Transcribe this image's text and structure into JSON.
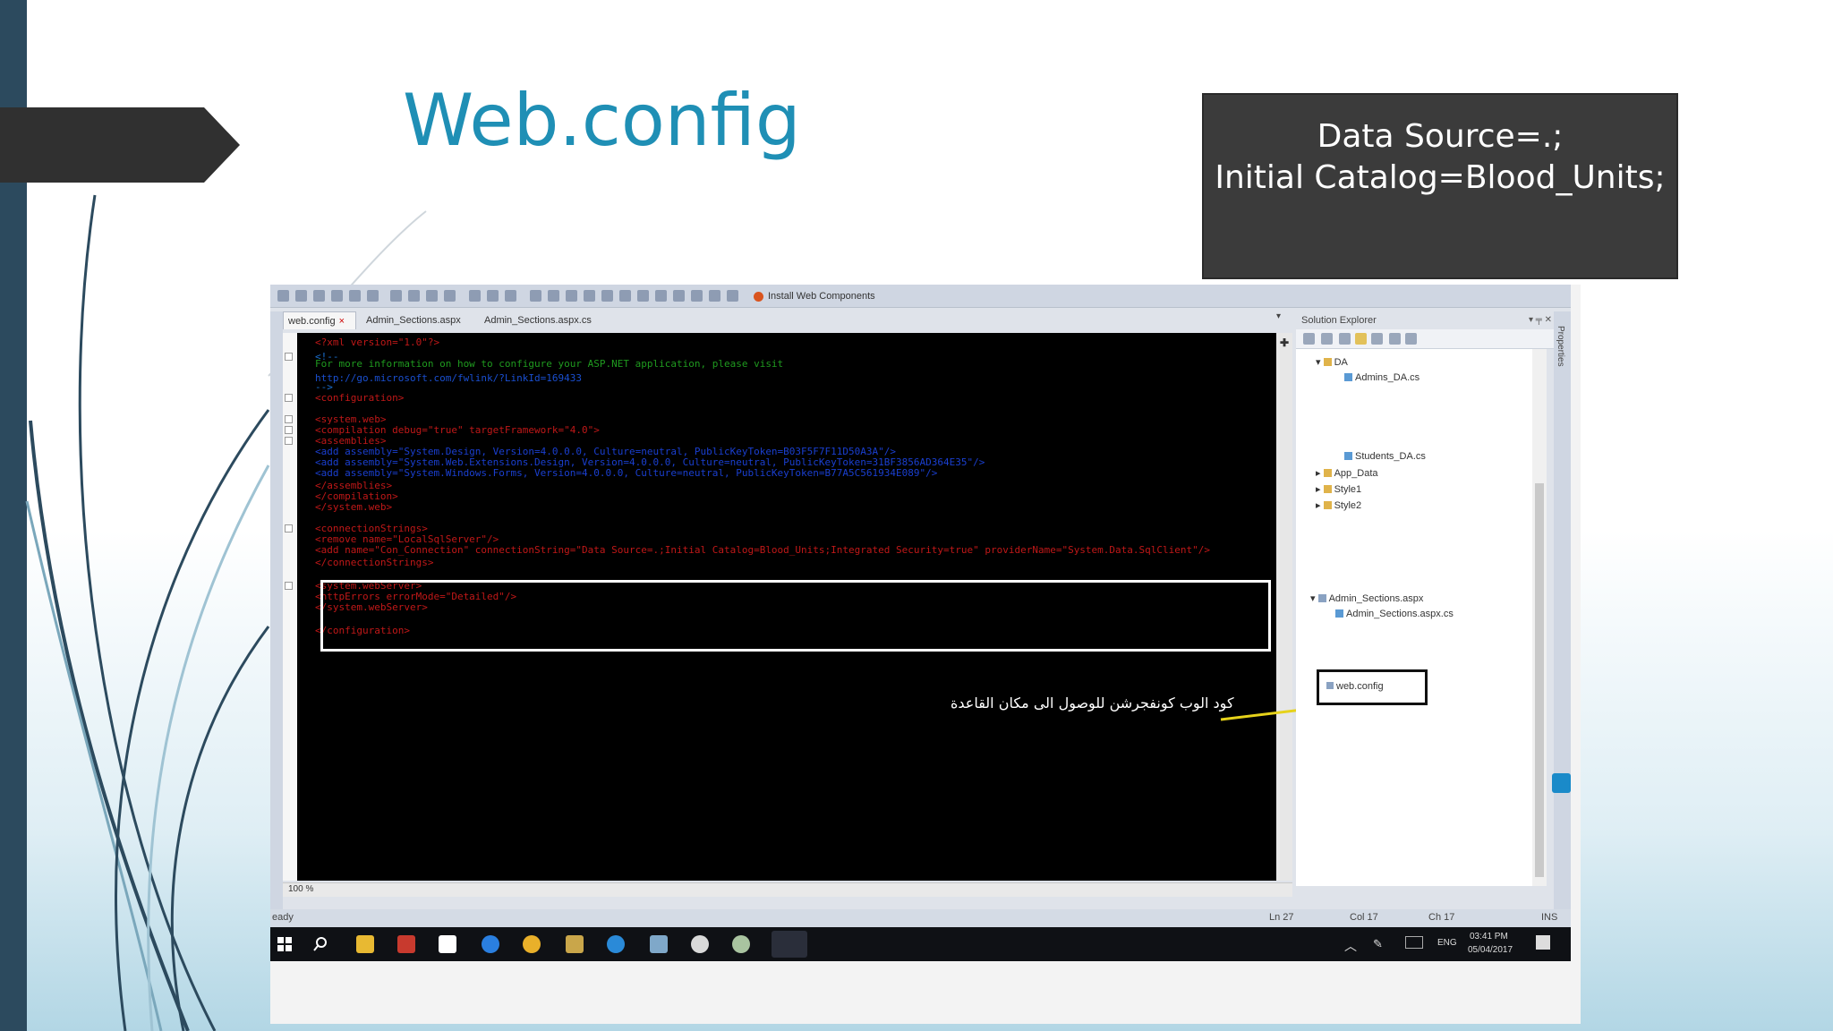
{
  "slide": {
    "title": "Web.config",
    "info_box_line1": "Data Source=.;",
    "info_box_line2": "Initial Catalog=Blood_Units;"
  },
  "ide": {
    "toolbar_button": "Install Web Components",
    "tabs": [
      "web.config",
      "Admin_Sections.aspx",
      "Admin_Sections.aspx.cs"
    ],
    "tab_close": "×",
    "zoom": "100 %",
    "code_lines": [
      {
        "text": "<?xml version=\"1.0\"?>",
        "color": "#c01818"
      },
      {
        "text": "<!--",
        "color": "#1a6fd0"
      },
      {
        "text": "  For more information on how to configure your ASP.NET application, please visit",
        "color": "#1f9a1f"
      },
      {
        "text": "  http://go.microsoft.com/fwlink/?LinkId=169433",
        "color": "#1a4fd0"
      },
      {
        "text": "  -->",
        "color": "#1a6fd0"
      },
      {
        "text": "<configuration>",
        "color": "#c01818"
      },
      {
        "text": "  <system.web>",
        "color": "#c01818"
      },
      {
        "text": "    <compilation debug=\"true\" targetFramework=\"4.0\">",
        "color": "#c01818"
      },
      {
        "text": "      <assemblies>",
        "color": "#c01818"
      },
      {
        "text": "        <add assembly=\"System.Design, Version=4.0.0.0, Culture=neutral, PublicKeyToken=B03F5F7F11D50A3A\"/>",
        "color": "#1a3fd0"
      },
      {
        "text": "        <add assembly=\"System.Web.Extensions.Design, Version=4.0.0.0, Culture=neutral, PublicKeyToken=31BF3856AD364E35\"/>",
        "color": "#1a3fd0"
      },
      {
        "text": "        <add assembly=\"System.Windows.Forms, Version=4.0.0.0, Culture=neutral, PublicKeyToken=B77A5C561934E089\"/>",
        "color": "#1a3fd0"
      },
      {
        "text": "      </assemblies>",
        "color": "#c01818"
      },
      {
        "text": "    </compilation>",
        "color": "#c01818"
      },
      {
        "text": "  </system.web>",
        "color": "#c01818"
      },
      {
        "text": "  <connectionStrings>",
        "color": "#c01818"
      },
      {
        "text": "    <remove name=\"LocalSqlServer\"/>",
        "color": "#c01818"
      },
      {
        "text": "    <add name=\"Con_Connection\" connectionString=\"Data Source=.;Initial Catalog=Blood_Units;Integrated Security=true\" providerName=\"System.Data.SqlClient\"/>",
        "color": "#c01818"
      },
      {
        "text": "  </connectionStrings>",
        "color": "#c01818"
      },
      {
        "text": "  <system.webServer>",
        "color": "#c01818"
      },
      {
        "text": "    <httpErrors errorMode=\"Detailed\"/>",
        "color": "#c01818"
      },
      {
        "text": "  </system.webServer>",
        "color": "#c01818"
      },
      {
        "text": "</configuration>",
        "color": "#c01818"
      }
    ],
    "annotation": "كود الوب كونفجرشن للوصول الى مكان القاعدة",
    "solution_explorer": {
      "title": "Solution Explorer",
      "header_buttons": "▾ ╤ ✕",
      "items": [
        {
          "label": "DA",
          "kind": "folder"
        },
        {
          "label": "Admins_DA.cs",
          "kind": "file"
        },
        {
          "label": "Students_DA.cs",
          "kind": "file"
        },
        {
          "label": "App_Data",
          "kind": "folder"
        },
        {
          "label": "Style1",
          "kind": "folder"
        },
        {
          "label": "Style2",
          "kind": "folder"
        },
        {
          "label": "Admin_Sections.aspx",
          "kind": "page"
        },
        {
          "label": "Admin_Sections.aspx.cs",
          "kind": "file"
        }
      ],
      "selected_item": "web.config",
      "properties_label": "Properties"
    },
    "status_bar": {
      "state": "eady",
      "line": "Ln 27",
      "col": "Col 17",
      "ch": "Ch 17",
      "mode": "INS"
    },
    "taskbar": {
      "language": "ENG",
      "time": "03:41 PM",
      "date": "05/04/2017"
    }
  }
}
